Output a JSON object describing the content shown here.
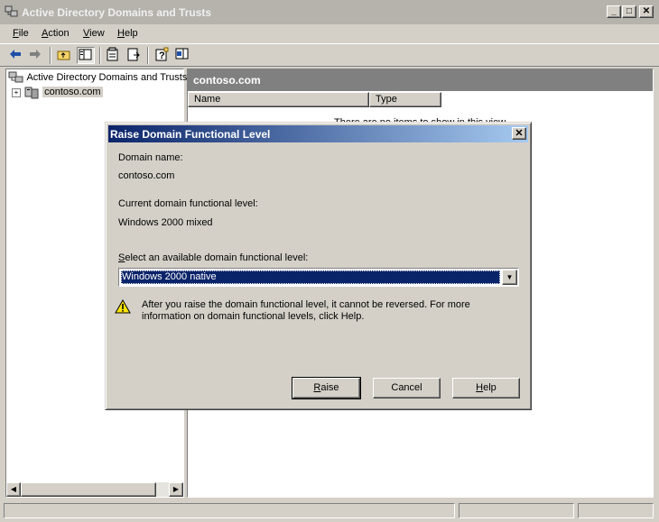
{
  "window": {
    "title": "Active Directory Domains and Trusts"
  },
  "menu": [
    {
      "accel": "F",
      "rest": "ile"
    },
    {
      "accel": "A",
      "rest": "ction"
    },
    {
      "accel": "V",
      "rest": "iew"
    },
    {
      "accel": "H",
      "rest": "elp"
    }
  ],
  "tree": {
    "root_label": "Active Directory Domains and Trusts",
    "child_label": "contoso.com"
  },
  "right_pane": {
    "header": "contoso.com",
    "columns": [
      "Name",
      "Type"
    ],
    "empty_message": "There are no items to show in this view."
  },
  "dialog": {
    "title": "Raise Domain Functional Level",
    "domain_name_label": "Domain name:",
    "domain_name_value": "contoso.com",
    "current_level_label": "Current domain functional level:",
    "current_level_value": "Windows 2000 mixed",
    "select_label_accel": "S",
    "select_label_rest": "elect an available domain functional level:",
    "selected_level": "Windows 2000 native",
    "warning_text": "After you raise the domain functional level, it cannot be reversed. For more information on domain functional levels, click Help.",
    "buttons": {
      "raise_accel": "R",
      "raise_rest": "aise",
      "cancel": "Cancel",
      "help_accel": "H",
      "help_rest": "elp"
    }
  },
  "colors": {
    "dialog_title_start": "#0a246a",
    "dialog_title_end": "#a6caf0",
    "selection": "#0a246a",
    "inactive_title": "#b5b3ac"
  },
  "icons": [
    "app-icon",
    "minimize-icon",
    "maximize-icon",
    "close-icon",
    "back-icon",
    "forward-icon",
    "up-folder-icon",
    "show-tree-icon",
    "properties-icon",
    "export-icon",
    "help-icon",
    "action-pane-icon",
    "domain-tree-icon",
    "domain-icon",
    "expand-icon",
    "warning-icon",
    "dropdown-arrow-icon"
  ]
}
